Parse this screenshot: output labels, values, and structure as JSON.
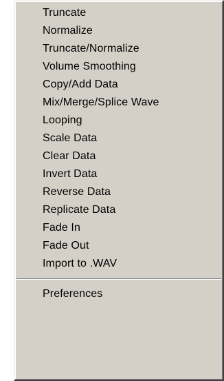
{
  "menu": {
    "items": [
      {
        "label": "Truncate"
      },
      {
        "label": "Normalize"
      },
      {
        "label": "Truncate/Normalize"
      },
      {
        "label": "Volume Smoothing"
      },
      {
        "label": "Copy/Add Data"
      },
      {
        "label": "Mix/Merge/Splice Wave"
      },
      {
        "label": "Looping"
      },
      {
        "label": "Scale Data"
      },
      {
        "label": "Clear Data"
      },
      {
        "label": "Invert Data"
      },
      {
        "label": "Reverse Data"
      },
      {
        "label": "Replicate Data"
      },
      {
        "label": "Fade In"
      },
      {
        "label": "Fade Out"
      },
      {
        "label": "Import to .WAV"
      }
    ],
    "footer_items": [
      {
        "label": "Preferences"
      }
    ]
  },
  "colors": {
    "menu_background": "#d4d0c8",
    "separator_dark": "#808080",
    "separator_light": "#ffffff"
  }
}
